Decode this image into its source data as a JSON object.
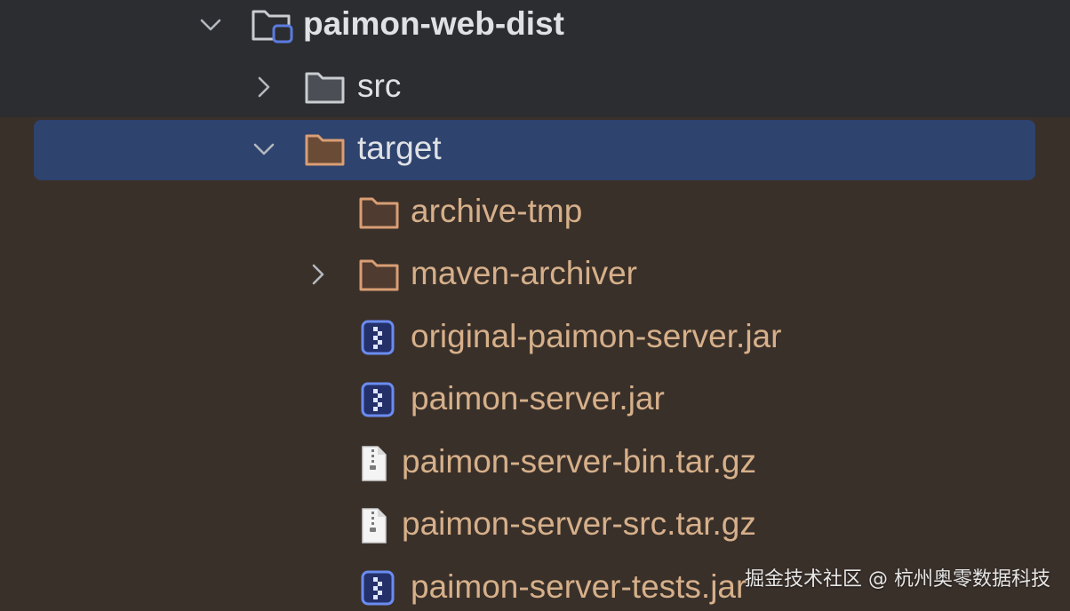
{
  "tree": {
    "root": {
      "label": "paimon-web-dist",
      "expanded": true,
      "icon": "module-folder-icon"
    },
    "src": {
      "label": "src",
      "expanded": false,
      "icon": "folder-icon"
    },
    "target": {
      "label": "target",
      "expanded": true,
      "selected": true,
      "icon": "excluded-folder-icon"
    },
    "children": [
      {
        "label": "archive-tmp",
        "type": "folder",
        "icon": "excluded-folder-icon"
      },
      {
        "label": "maven-archiver",
        "type": "folder",
        "collapsed": true,
        "icon": "excluded-folder-icon"
      },
      {
        "label": "original-paimon-server.jar",
        "type": "jar",
        "icon": "jar-file-icon"
      },
      {
        "label": "paimon-server.jar",
        "type": "jar",
        "icon": "jar-file-icon"
      },
      {
        "label": "paimon-server-bin.tar.gz",
        "type": "archive",
        "icon": "gz-archive-icon"
      },
      {
        "label": "paimon-server-src.tar.gz",
        "type": "archive",
        "icon": "gz-archive-icon"
      },
      {
        "label": "paimon-server-tests.jar",
        "type": "jar",
        "icon": "jar-file-icon"
      }
    ]
  },
  "colors": {
    "top_background": "#2b2d30",
    "excluded_background": "#3a302a",
    "selection": "#2e436e",
    "text": "#dfe1e5",
    "excluded_text": "#d6b08a",
    "jar_icon": "#5b7be0"
  },
  "watermark": "掘金技术社区 @ 杭州奥零数据科技"
}
